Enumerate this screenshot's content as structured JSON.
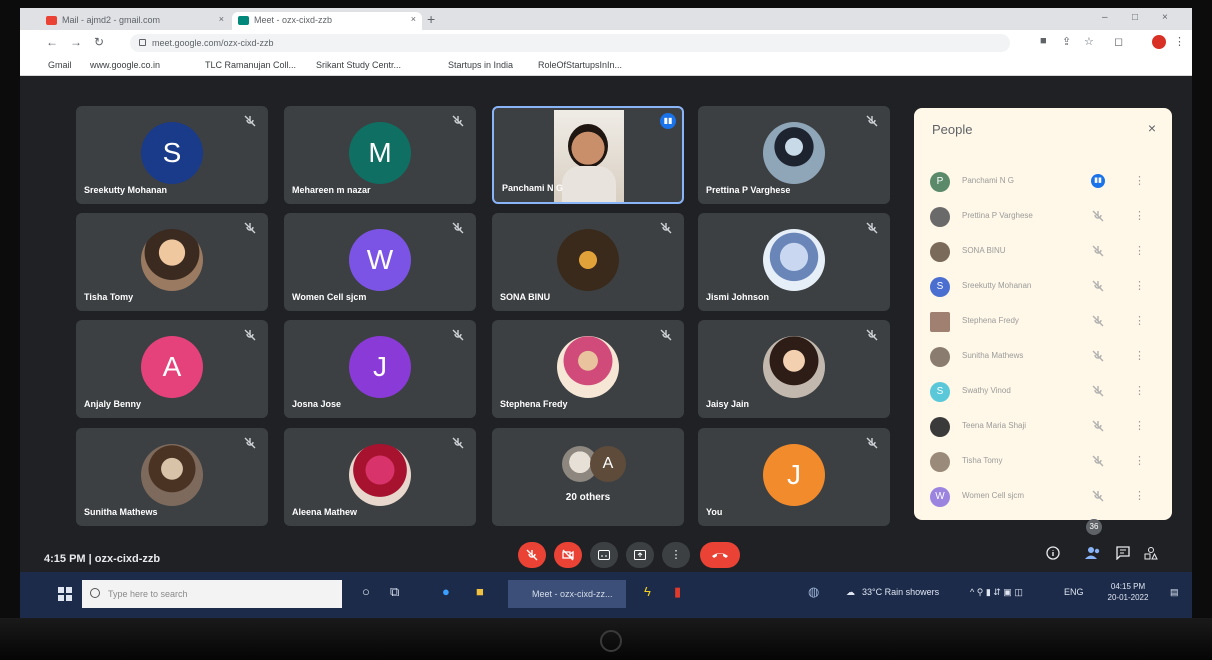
{
  "browser": {
    "tabs": [
      {
        "label": "Mail - ajmd2 - gmail.com",
        "close": "×"
      },
      {
        "label": "Meet - ozx-cixd-zzb",
        "close": "×"
      }
    ],
    "new_tab": "+",
    "window_controls": {
      "minimize": "–",
      "maximize": "□",
      "close": "×"
    },
    "url": "meet.google.com/ozx-cixd-zzb",
    "bookmarks": [
      "Gmail",
      "www.google.co.in",
      "TLC Ramanujan Coll...",
      "Srikant Study Centr...",
      "Startups in India",
      "RoleOfStartupsInIn..."
    ]
  },
  "meeting": {
    "tiles": [
      {
        "name": "Sreekutty Mohanan",
        "initial": "S",
        "color": "#1a3a8a"
      },
      {
        "name": "Mehareen m nazar",
        "initial": "M",
        "color": "#0f6f63"
      },
      {
        "name": "Panchami N G",
        "speaking": true
      },
      {
        "name": "Prettina P Varghese"
      },
      {
        "name": "Tisha Tomy"
      },
      {
        "name": "Women Cell sjcm",
        "initial": "W",
        "color": "#7b54e5"
      },
      {
        "name": "SONA BINU"
      },
      {
        "name": "Jismi Johnson"
      },
      {
        "name": "Anjaly Benny",
        "initial": "A",
        "color": "#e5417a"
      },
      {
        "name": "Josna Jose",
        "initial": "J",
        "color": "#8a3ad6"
      },
      {
        "name": "Stephena Fredy"
      },
      {
        "name": "Jaisy Jain"
      },
      {
        "name": "Sunitha Mathews"
      },
      {
        "name": "Aleena Mathew"
      },
      {
        "name": "20 others",
        "initial": "A"
      },
      {
        "name": "You",
        "initial": "J",
        "color": "#f28b2c"
      }
    ],
    "info": "4:15 PM  |  ozx-cixd-zzb",
    "participant_count": "36"
  },
  "people_panel": {
    "title": "People",
    "close": "×",
    "list": [
      {
        "name": "Panchami N G",
        "initial": "P",
        "color": "#5a8a6a",
        "speaking": true
      },
      {
        "name": "Prettina P Varghese",
        "photo": true
      },
      {
        "name": "SONA BINU",
        "photo": true
      },
      {
        "name": "Sreekutty Mohanan",
        "initial": "S",
        "color": "#4a6fd0"
      },
      {
        "name": "Stephena Fredy",
        "photo": true
      },
      {
        "name": "Sunitha Mathews",
        "photo": true
      },
      {
        "name": "Swathy Vinod",
        "initial": "S",
        "color": "#5ac8d8"
      },
      {
        "name": "Teena Maria Shaji",
        "photo": true
      },
      {
        "name": "Tisha Tomy",
        "photo": true
      },
      {
        "name": "Women Cell sjcm",
        "initial": "W",
        "color": "#9a84e0"
      }
    ],
    "more_icon": "⋮"
  },
  "taskbar": {
    "search_placeholder": "Type here to search",
    "active_app": "Meet - ozx-cixd-zz...",
    "weather": "33°C  Rain showers",
    "lang": "ENG",
    "time": "04:15 PM",
    "date": "20-01-2022"
  }
}
